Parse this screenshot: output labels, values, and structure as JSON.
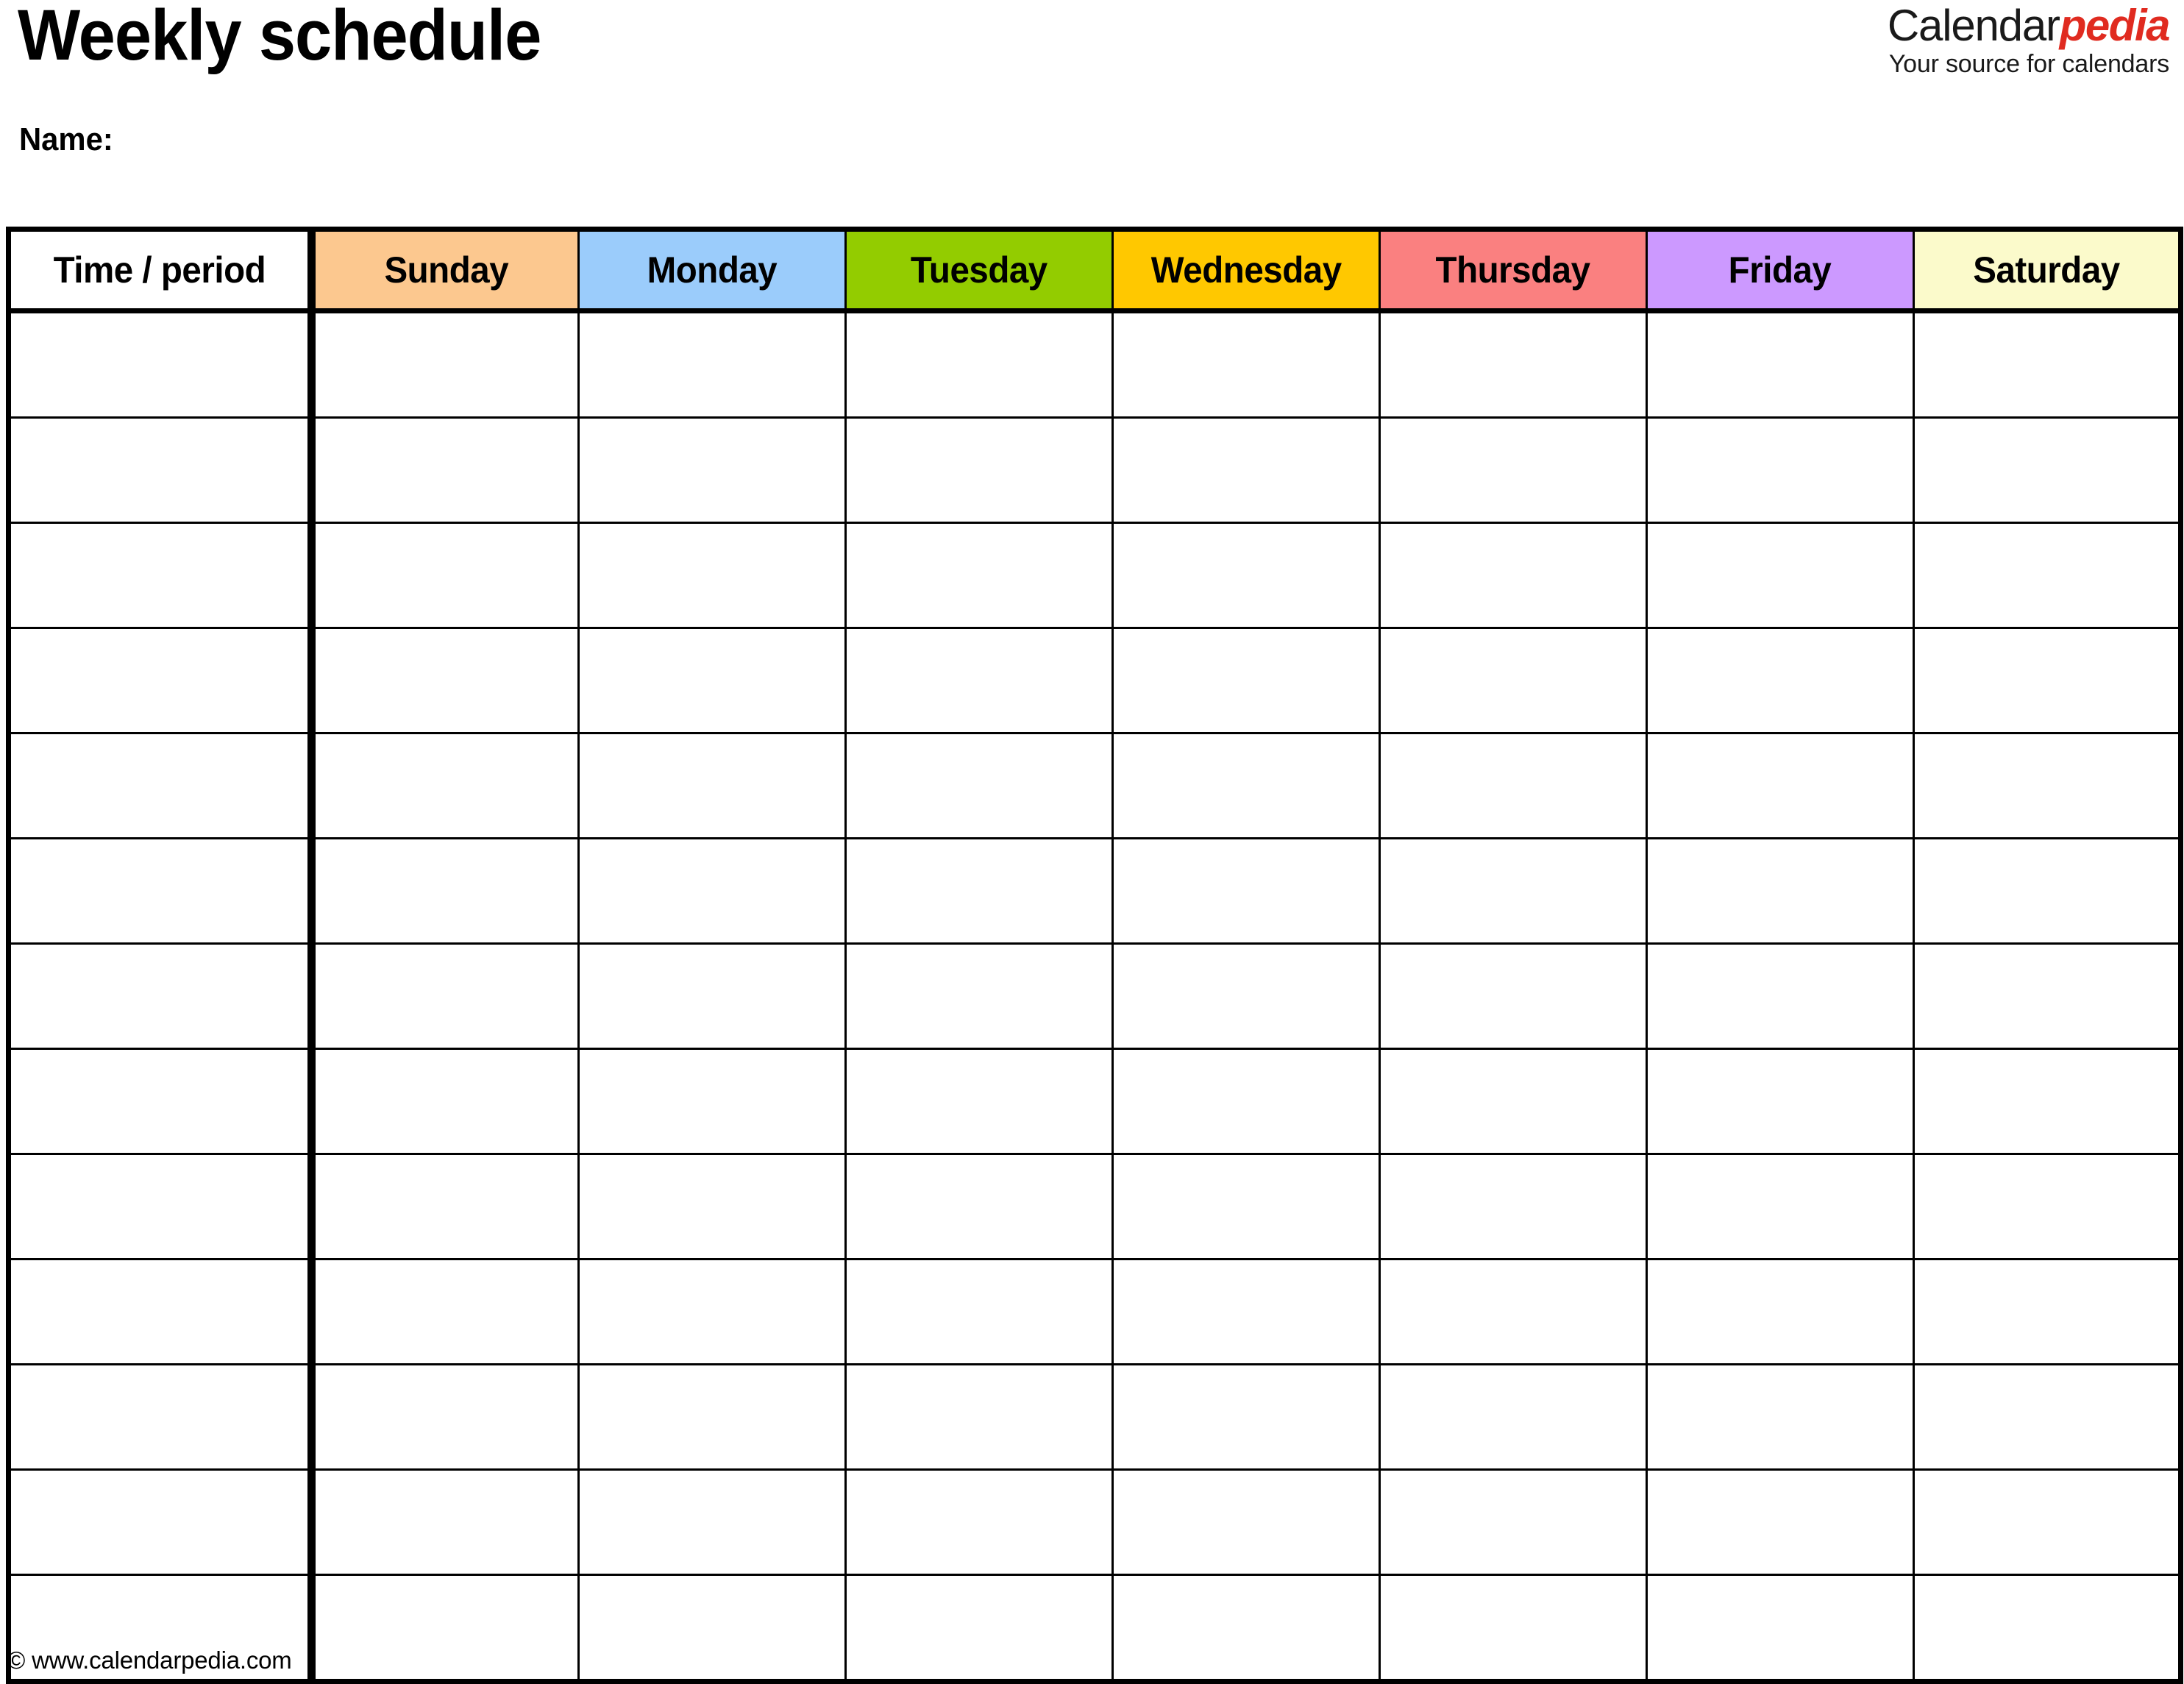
{
  "document": {
    "title": "Weekly schedule",
    "name_label": "Name:"
  },
  "logo": {
    "brand_first": "Calendar",
    "brand_second": "pedia",
    "tagline": "Your source for calendars",
    "brand_first_color": "#1a1a1a",
    "brand_second_color": "#e02b20"
  },
  "table": {
    "columns": [
      {
        "label": "Time / period",
        "bg": "#ffffff"
      },
      {
        "label": "Sunday",
        "bg": "#fcc88f"
      },
      {
        "label": "Monday",
        "bg": "#9bccfb"
      },
      {
        "label": "Tuesday",
        "bg": "#93cc00"
      },
      {
        "label": "Wednesday",
        "bg": "#ffc800"
      },
      {
        "label": "Thursday",
        "bg": "#fa8080"
      },
      {
        "label": "Friday",
        "bg": "#cc99ff"
      },
      {
        "label": "Saturday",
        "bg": "#fbfacb"
      }
    ],
    "row_count": 13,
    "rows": [
      [
        "",
        "",
        "",
        "",
        "",
        "",
        "",
        ""
      ],
      [
        "",
        "",
        "",
        "",
        "",
        "",
        "",
        ""
      ],
      [
        "",
        "",
        "",
        "",
        "",
        "",
        "",
        ""
      ],
      [
        "",
        "",
        "",
        "",
        "",
        "",
        "",
        ""
      ],
      [
        "",
        "",
        "",
        "",
        "",
        "",
        "",
        ""
      ],
      [
        "",
        "",
        "",
        "",
        "",
        "",
        "",
        ""
      ],
      [
        "",
        "",
        "",
        "",
        "",
        "",
        "",
        ""
      ],
      [
        "",
        "",
        "",
        "",
        "",
        "",
        "",
        ""
      ],
      [
        "",
        "",
        "",
        "",
        "",
        "",
        "",
        ""
      ],
      [
        "",
        "",
        "",
        "",
        "",
        "",
        "",
        ""
      ],
      [
        "",
        "",
        "",
        "",
        "",
        "",
        "",
        ""
      ],
      [
        "",
        "",
        "",
        "",
        "",
        "",
        "",
        ""
      ],
      [
        "",
        "",
        "",
        "",
        "",
        "",
        "",
        ""
      ]
    ]
  },
  "footer": {
    "copyright": "© www.calendarpedia.com"
  }
}
